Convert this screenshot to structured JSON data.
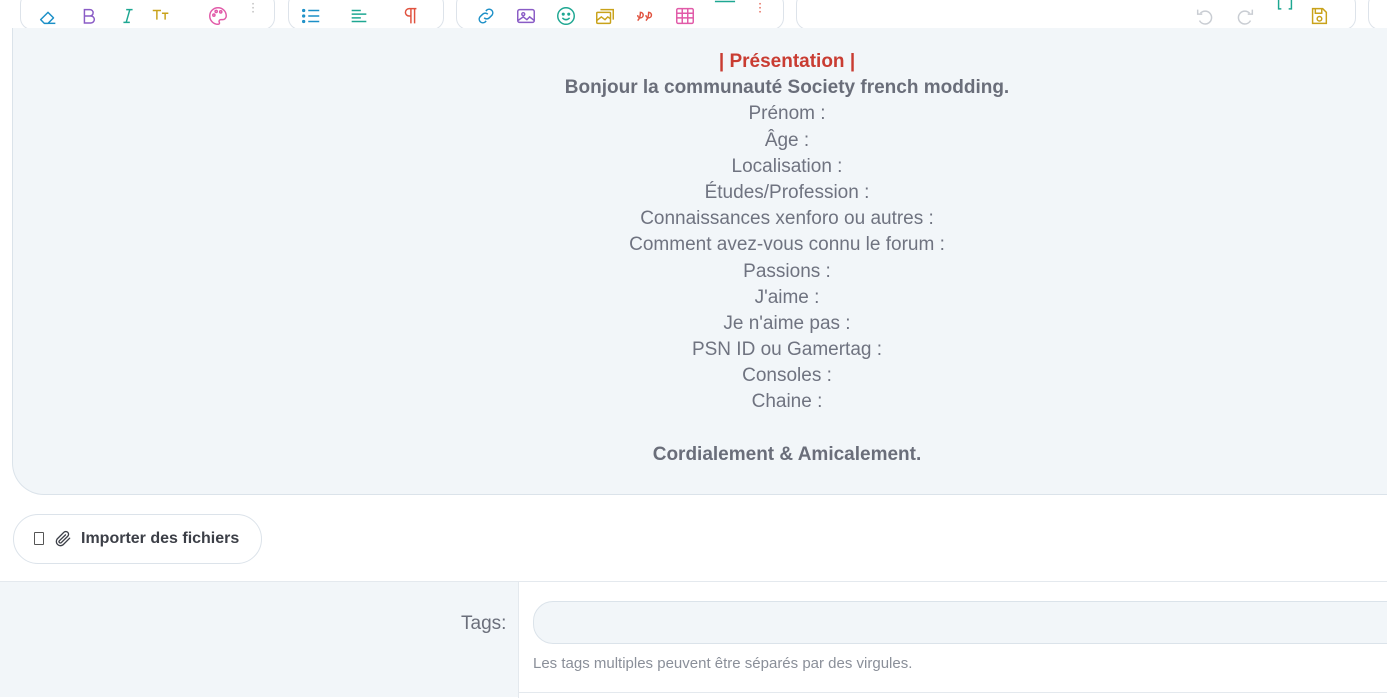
{
  "toolbar": {
    "groups": [
      {
        "name": "text-format",
        "buttons": [
          "eraser-icon",
          "bold-icon",
          "italic-icon",
          "font-size-icon",
          "palette-icon",
          "more-icon"
        ]
      },
      {
        "name": "paragraph",
        "buttons": [
          "list-icon",
          "align-icon",
          "paragraph-icon"
        ]
      },
      {
        "name": "insert",
        "buttons": [
          "link-icon",
          "image-icon",
          "smiley-icon",
          "media-icon",
          "quote-icon",
          "table-icon",
          "hr-icon",
          "more-icon"
        ]
      },
      {
        "name": "history",
        "buttons": [
          "undo-icon",
          "redo-icon",
          "bbcode-icon",
          "save-draft-icon"
        ]
      }
    ],
    "colors": {
      "eraser": "#1b8fc7",
      "bold": "#8a5cc6",
      "italic": "#1ea792",
      "font_size": "#c9a21a",
      "palette": "#e15aa8",
      "list": "#1b8fc7",
      "align": "#1ea792",
      "paragraph": "#e0523f",
      "link": "#1b8fc7",
      "image": "#8a5cc6",
      "smiley": "#1ea792",
      "media": "#c9a21a",
      "quote": "#e0523f",
      "table": "#e15aa8",
      "hr": "#1ea792",
      "undo": "#c9cdd3",
      "bbcode": "#1ea792",
      "save": "#c9a21a"
    }
  },
  "editor": {
    "title": "| Présentation |",
    "greeting": "Bonjour la communauté Society french modding.",
    "fields": [
      "Prénom :",
      "Âge :",
      "Localisation :",
      "Études/Profession :",
      "Connaissances xenforo ou autres :",
      "Comment avez-vous connu le forum :",
      "Passions :",
      "J'aime :",
      "Je n'aime pas :",
      "PSN ID ou Gamertag :",
      "Consoles :",
      "Chaine :"
    ],
    "closing": "Cordialement & Amicalement."
  },
  "attach": {
    "label": "Importer des fichiers"
  },
  "tags": {
    "label": "Tags:",
    "value": "",
    "hint": "Les tags multiples peuvent être séparés par des virgules."
  }
}
